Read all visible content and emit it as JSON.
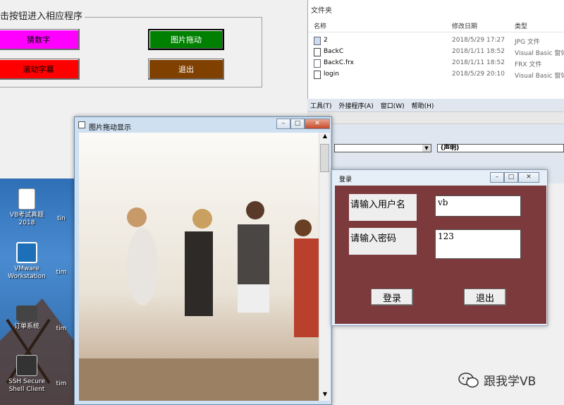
{
  "main_form": {
    "frame_title": "击按钮进入相应程序",
    "buttons": [
      {
        "label": "猜数字",
        "color": "#ff00ff"
      },
      {
        "label": "图片拖动",
        "color": "#008000"
      },
      {
        "label": "滚动字幕",
        "color": "#ff0000"
      },
      {
        "label": "退出",
        "color": "#804000"
      }
    ]
  },
  "explorer": {
    "title": "文件夹",
    "columns": [
      "名称",
      "修改日期",
      "类型"
    ],
    "files": [
      {
        "name": "2",
        "date": "2018/5/29 17:27",
        "type": "JPG 文件"
      },
      {
        "name": "BackC",
        "date": "2018/1/11 18:52",
        "type": "Visual Basic 窗体"
      },
      {
        "name": "BackC.frx",
        "date": "2018/1/11 18:52",
        "type": "FRX 文件"
      },
      {
        "name": "login",
        "date": "2018/5/29 20:10",
        "type": "Visual Basic 窗体"
      }
    ]
  },
  "ide": {
    "menu": [
      "工具(T)",
      "外接程序(A)",
      "窗口(W)",
      "帮助(H)"
    ],
    "combo_right": "(声明)"
  },
  "desktop": {
    "icons": [
      {
        "label": "VB考试真题 2018",
        "icon": "document-icon"
      },
      {
        "label": "VMware Workstation",
        "icon": "vmware-icon"
      },
      {
        "label": "订单系统",
        "icon": "video-icon"
      },
      {
        "label": "SSH Secure Shell Client",
        "icon": "ssh-icon"
      }
    ],
    "partial_labels": [
      "tin",
      "tim",
      "tim",
      "tim"
    ]
  },
  "picture_window": {
    "title": "图片拖动显示"
  },
  "login_window": {
    "title": "登录",
    "username_label": "请输入用户名",
    "password_label": "请输入密码",
    "username_value": "vb",
    "password_value": "123",
    "login_button": "登录",
    "exit_button": "退出"
  },
  "watermark": {
    "text": "跟我学VB"
  }
}
